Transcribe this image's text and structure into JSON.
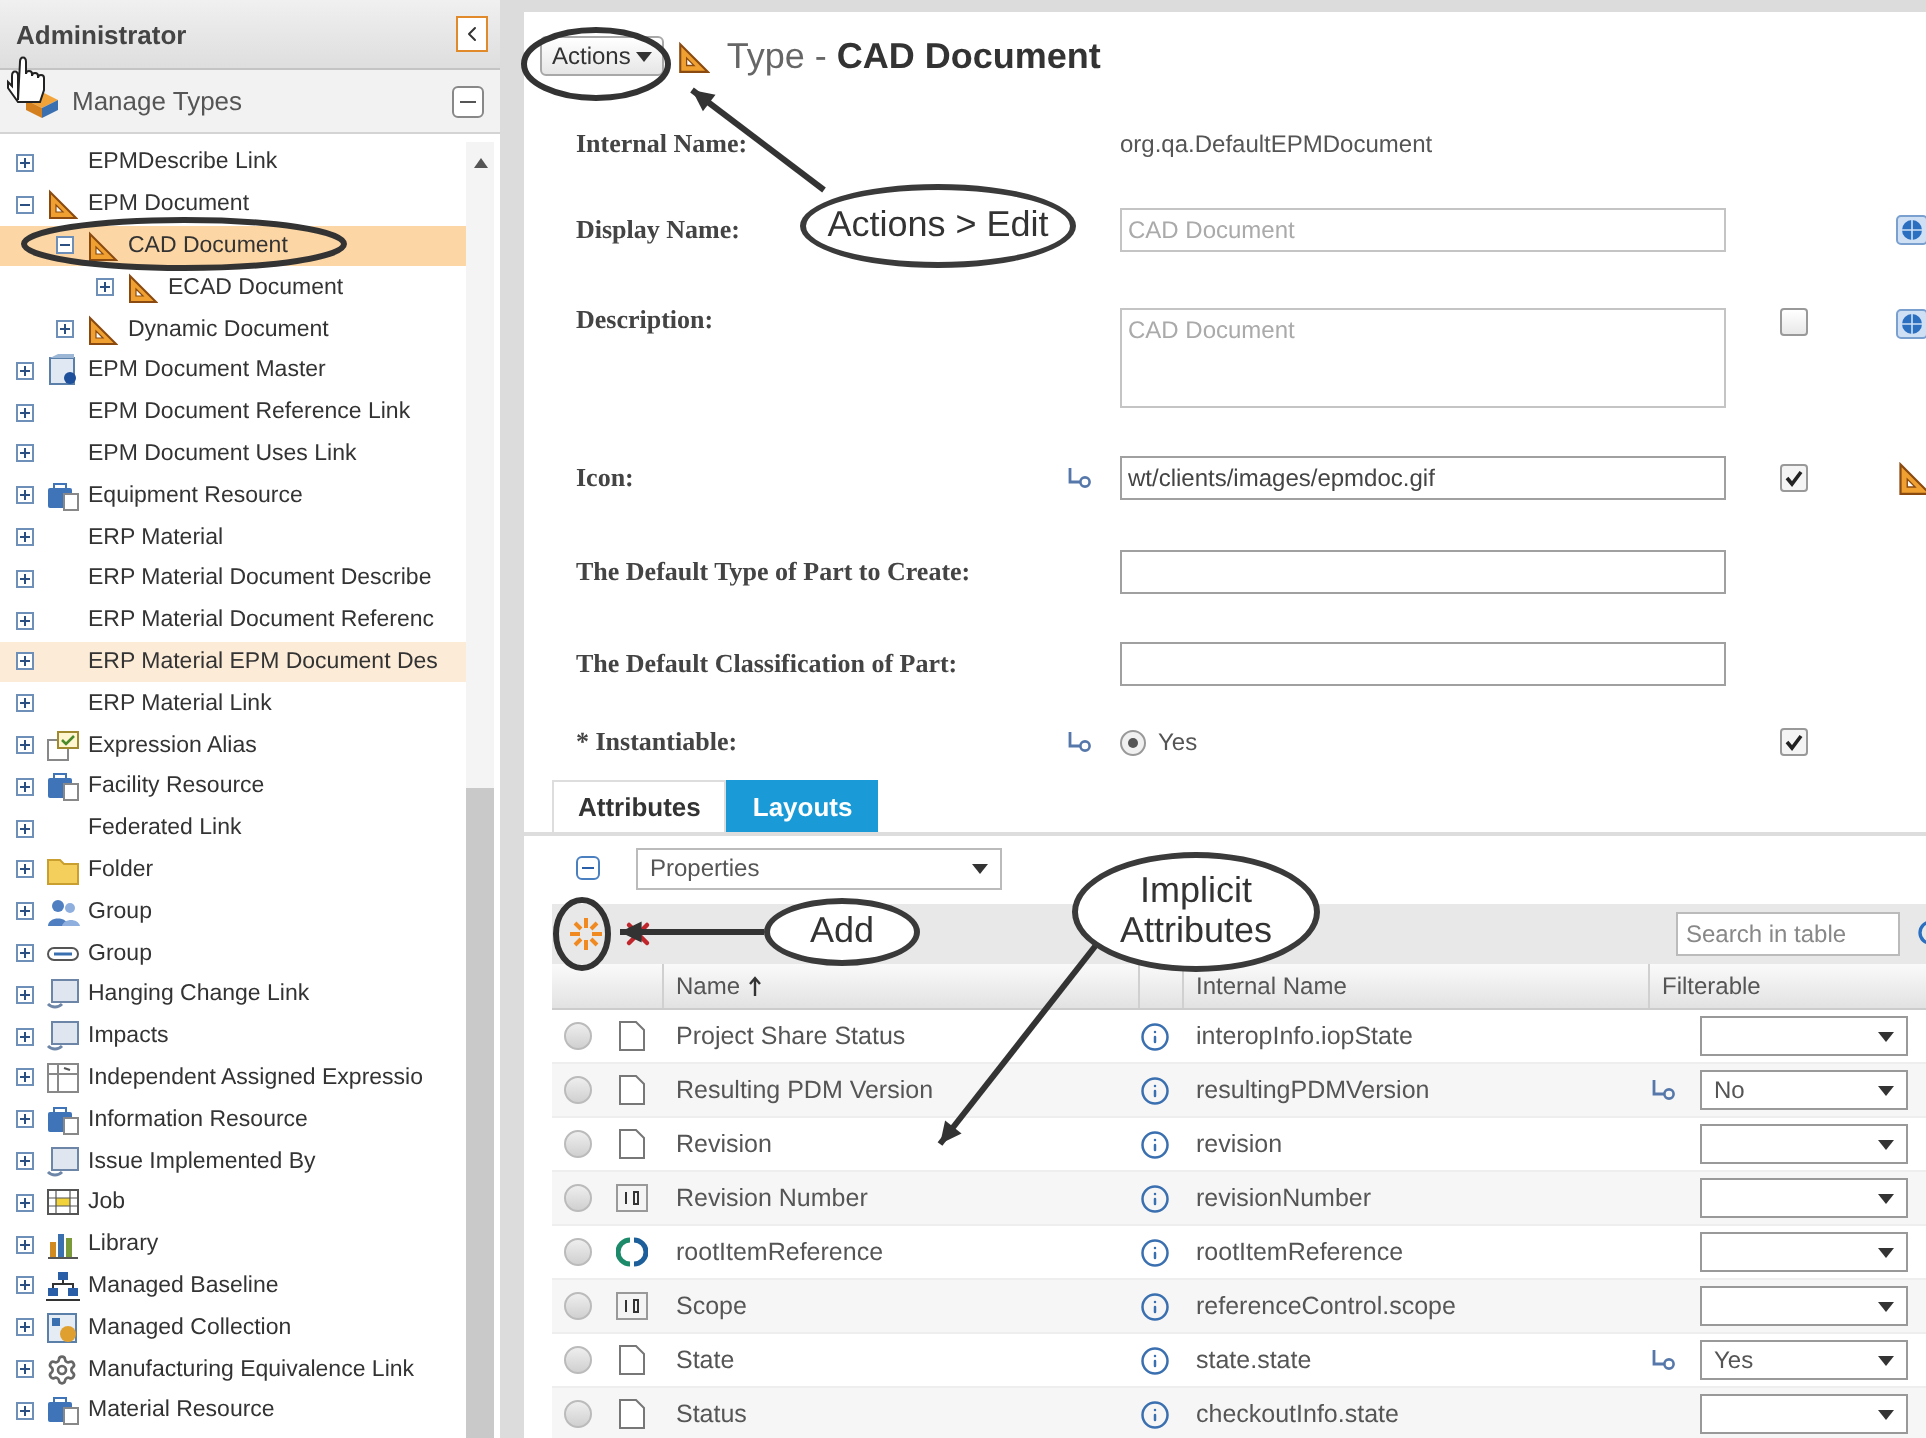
{
  "left_panel": {
    "title": "Administrator",
    "section": "Manage Types"
  },
  "tree": [
    {
      "label": "EPMDescribe Link",
      "expanded": false,
      "selected": false,
      "highlighted": false
    },
    {
      "label": "EPM Document",
      "kind": "set_square",
      "expanded": true,
      "selected": false,
      "highlighted": false,
      "children": [
        {
          "label": "CAD Document",
          "kind": "set_square",
          "expanded": true,
          "selected": true,
          "highlighted": false,
          "children": [
            {
              "label": "ECAD Document",
              "kind": "set_square",
              "expanded": false,
              "selected": false,
              "highlighted": false
            }
          ]
        },
        {
          "label": "Dynamic Document",
          "kind": "set_square",
          "expanded": false,
          "selected": false,
          "highlighted": false
        }
      ]
    },
    {
      "label": "EPM Document Master",
      "kind": "master",
      "expanded": false,
      "selected": false,
      "highlighted": false
    },
    {
      "label": "EPM Document Reference Link",
      "expanded": false,
      "selected": false,
      "highlighted": false
    },
    {
      "label": "EPM Document Uses Link",
      "expanded": false,
      "selected": false,
      "highlighted": false
    },
    {
      "label": "Equipment Resource",
      "kind": "resource",
      "expanded": false,
      "selected": false,
      "highlighted": false
    },
    {
      "label": "ERP Material",
      "expanded": false,
      "selected": false,
      "highlighted": false
    },
    {
      "label": "ERP Material Document Describe",
      "expanded": false,
      "selected": false,
      "highlighted": false
    },
    {
      "label": "ERP Material Document Referenc",
      "expanded": false,
      "selected": false,
      "highlighted": false
    },
    {
      "label": "ERP Material EPM Document Des",
      "expanded": false,
      "selected": false,
      "highlighted": true
    },
    {
      "label": "ERP Material Link",
      "expanded": false,
      "selected": false,
      "highlighted": false
    },
    {
      "label": "Expression Alias",
      "kind": "alias",
      "expanded": false,
      "selected": false,
      "highlighted": false
    },
    {
      "label": "Facility Resource",
      "kind": "resource",
      "expanded": false,
      "selected": false,
      "highlighted": false
    },
    {
      "label": "Federated Link",
      "expanded": false,
      "selected": false,
      "highlighted": false
    },
    {
      "label": "Folder",
      "kind": "folder",
      "expanded": false,
      "selected": false,
      "highlighted": false
    },
    {
      "label": "Group",
      "kind": "people",
      "expanded": false,
      "selected": false,
      "highlighted": false
    },
    {
      "label": "Group",
      "kind": "shape",
      "expanded": false,
      "selected": false,
      "highlighted": false
    },
    {
      "label": "Hanging Change Link",
      "kind": "link",
      "expanded": false,
      "selected": false,
      "highlighted": false
    },
    {
      "label": "Impacts",
      "kind": "link",
      "expanded": false,
      "selected": false,
      "highlighted": false
    },
    {
      "label": "Independent Assigned Expressio",
      "kind": "table",
      "expanded": false,
      "selected": false,
      "highlighted": false
    },
    {
      "label": "Information Resource",
      "kind": "resource",
      "expanded": false,
      "selected": false,
      "highlighted": false
    },
    {
      "label": "Issue Implemented By",
      "kind": "link",
      "expanded": false,
      "selected": false,
      "highlighted": false
    },
    {
      "label": "Job",
      "kind": "grid",
      "expanded": false,
      "selected": false,
      "highlighted": false
    },
    {
      "label": "Library",
      "kind": "bars",
      "expanded": false,
      "selected": false,
      "highlighted": false
    },
    {
      "label": "Managed Baseline",
      "kind": "hierarchy",
      "expanded": false,
      "selected": false,
      "highlighted": false
    },
    {
      "label": "Managed Collection",
      "kind": "boxes",
      "expanded": false,
      "selected": false,
      "highlighted": false
    },
    {
      "label": "Manufacturing Equivalence Link",
      "kind": "gear",
      "expanded": false,
      "selected": false,
      "highlighted": false
    },
    {
      "label": "Material Resource",
      "kind": "resource",
      "expanded": false,
      "selected": false,
      "highlighted": false
    }
  ],
  "header": {
    "actions": "Actions",
    "title": "Type - **CAD Document**"
  },
  "form": [
    {
      "kind": "text",
      "label": "Internal Name:",
      "value": "org.qa.DefaultEPMDocument"
    },
    {
      "kind": "input",
      "label": "Display Name:",
      "value": "CAD Document",
      "disabled": true,
      "localize": true
    },
    {
      "kind": "textarea",
      "label": "Description:",
      "value": "CAD Document",
      "disabled": true,
      "checkbox": {
        "checked": false
      },
      "localize": true
    },
    {
      "kind": "input",
      "label": "Icon:",
      "value": "wt/clients/images/epmdoc.gif",
      "inherited": true,
      "checkbox": {
        "checked": true
      },
      "preview": true
    },
    {
      "kind": "input",
      "label": "The Default Type of Part to Create:"
    },
    {
      "kind": "input",
      "label": "The Default Classification of Part:"
    },
    {
      "kind": "radio",
      "label": "* Instantiable:",
      "inherited": true,
      "option": "Yes",
      "selected": true,
      "checkbox": {
        "checked": true
      }
    }
  ],
  "tabs": [
    {
      "label": "Attributes",
      "selected": true
    },
    {
      "label": "Layouts",
      "selected": false
    }
  ],
  "properties": {
    "value": "Properties"
  },
  "table": {
    "search": {
      "placeholder": "Search in table"
    },
    "columns": [
      {
        "label": "Name",
        "sorted": true
      },
      {
        "label": "Internal Name"
      },
      {
        "label": "Filterable"
      }
    ],
    "rows": [
      {
        "kind": "doc",
        "name": "Project Share Status",
        "internal_name": "interopInfo.iopState",
        "inherited": false,
        "selected": false
      },
      {
        "kind": "doc",
        "name": "Resulting PDM Version",
        "internal_name": "resultingPDMVersion",
        "inherited": true,
        "filterable": "No",
        "selected": false
      },
      {
        "kind": "doc",
        "name": "Revision",
        "internal_name": "revision",
        "inherited": false,
        "selected": false
      },
      {
        "kind": "number",
        "name": "Revision Number",
        "internal_name": "revisionNumber",
        "inherited": false,
        "selected": false
      },
      {
        "kind": "reference",
        "name": "rootItemReference",
        "internal_name": "rootItemReference",
        "inherited": false,
        "selected": false
      },
      {
        "kind": "number",
        "name": "Scope",
        "internal_name": "referenceControl.scope",
        "inherited": false,
        "selected": false
      },
      {
        "kind": "doc",
        "name": "State",
        "internal_name": "state.state",
        "inherited": true,
        "filterable": "Yes",
        "selected": false
      },
      {
        "kind": "doc",
        "name": "Status",
        "internal_name": "checkoutInfo.state",
        "inherited": false,
        "selected": false
      }
    ]
  },
  "callouts": [
    {
      "text": "Actions > Edit"
    },
    {
      "text": "Add"
    },
    {
      "text": "Implicit Attributes"
    }
  ]
}
